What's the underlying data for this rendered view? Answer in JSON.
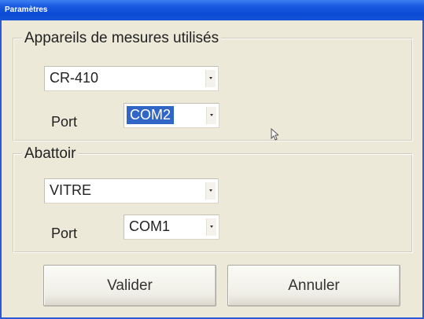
{
  "window": {
    "title": "Paramètres"
  },
  "devices_group": {
    "legend": "Appareils de mesures utilisés",
    "device_combo": {
      "value": "CR-410"
    },
    "port_label": "Port",
    "port_combo": {
      "value": "COM2"
    }
  },
  "slaughterhouse_group": {
    "legend": "Abattoir",
    "site_combo": {
      "value": "VITRE"
    },
    "port_label": "Port",
    "port_combo": {
      "value": "COM1"
    }
  },
  "buttons": {
    "validate": "Valider",
    "cancel": "Annuler"
  },
  "colors": {
    "titlebar": "#0b4ad4",
    "dialog_background": "#ece9d8",
    "selection": "#3166c7"
  },
  "icons": {
    "combo_arrow": "chevron-down-icon",
    "mouse_cursor": "mouse-pointer-icon"
  }
}
